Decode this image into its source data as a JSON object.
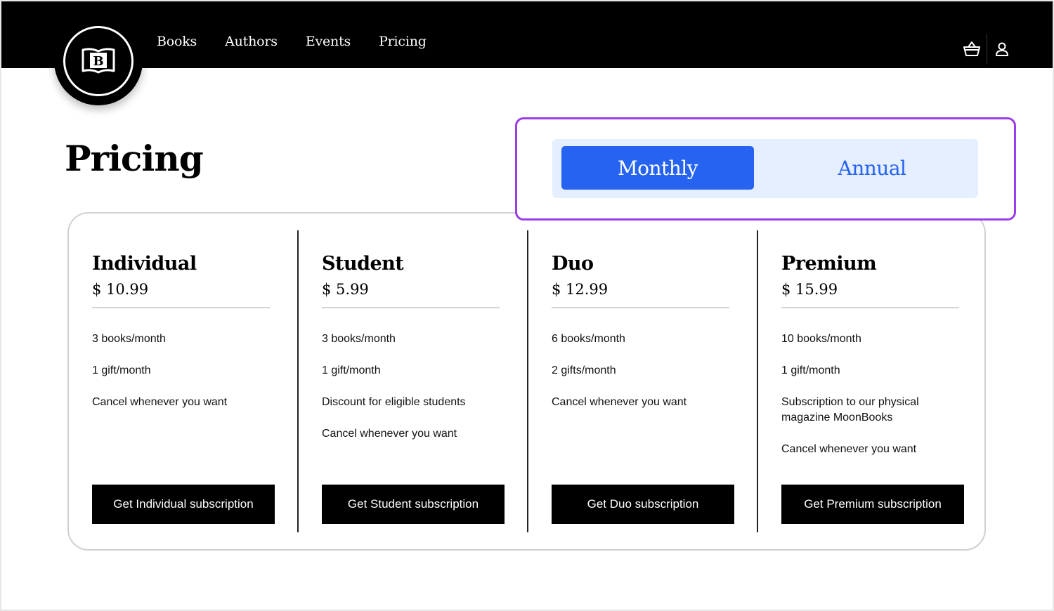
{
  "nav": {
    "logo_letter": "B",
    "links": [
      "Books",
      "Authors",
      "Events",
      "Pricing"
    ],
    "cart_icon": "basket-icon",
    "account_icon": "user-icon"
  },
  "page": {
    "title": "Pricing"
  },
  "billing_toggle": {
    "options": [
      "Monthly",
      "Annual"
    ],
    "selected": "Monthly"
  },
  "plans": [
    {
      "name": "Individual",
      "price": "$ 10.99",
      "features": [
        "3 books/month",
        "1 gift/month",
        "Cancel whenever you want"
      ],
      "cta": "Get Individual subscription"
    },
    {
      "name": "Student",
      "price": "$ 5.99",
      "features": [
        "3 books/month",
        "1 gift/month",
        "Discount for eligible students",
        "Cancel whenever you want"
      ],
      "cta": "Get Student subscription"
    },
    {
      "name": "Duo",
      "price": "$ 12.99",
      "features": [
        "6 books/month",
        "2 gifts/month",
        "Cancel whenever you want"
      ],
      "cta": "Get Duo subscription"
    },
    {
      "name": "Premium",
      "price": "$ 15.99",
      "features": [
        "10 books/month",
        "1 gift/month",
        "Subscription to our physical magazine MoonBooks",
        "Cancel whenever you want"
      ],
      "cta": "Get Premium subscription"
    }
  ],
  "colors": {
    "accent": "#2563f0",
    "toggle_track": "#e5efff",
    "highlight": "#9b3ee8",
    "topbar": "#000000"
  }
}
